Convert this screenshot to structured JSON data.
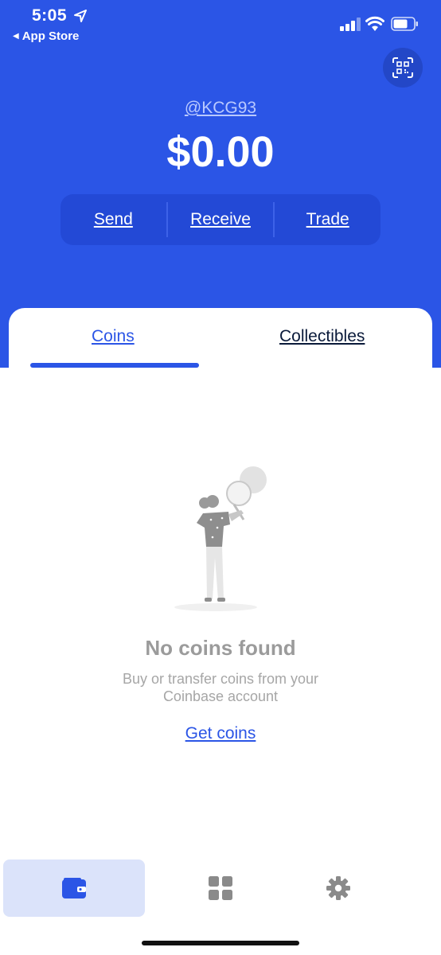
{
  "status_bar": {
    "time": "5:05",
    "back_app": "App Store",
    "icons": [
      "location-arrow-icon",
      "signal-icon",
      "wifi-icon",
      "battery-icon"
    ]
  },
  "header": {
    "username": "@KCG93",
    "balance": "$0.00",
    "actions": {
      "send": "Send",
      "receive": "Receive",
      "trade": "Trade"
    },
    "qr_icon": "qr-scan-icon"
  },
  "tabs": {
    "coins": "Coins",
    "collectibles": "Collectibles",
    "active": "Coins"
  },
  "empty_state": {
    "title": "No coins found",
    "subtitle": "Buy or transfer coins from your Coinbase account",
    "cta": "Get coins"
  },
  "bottom_nav": {
    "items": [
      "wallet-icon",
      "apps-grid-icon",
      "settings-gear-icon"
    ],
    "active": "wallet-icon"
  },
  "colors": {
    "brand_blue": "#2b55e6",
    "action_bar": "#2349d6",
    "muted_text": "#9b9b9b",
    "active_nav_bg": "#dbe3fa"
  }
}
